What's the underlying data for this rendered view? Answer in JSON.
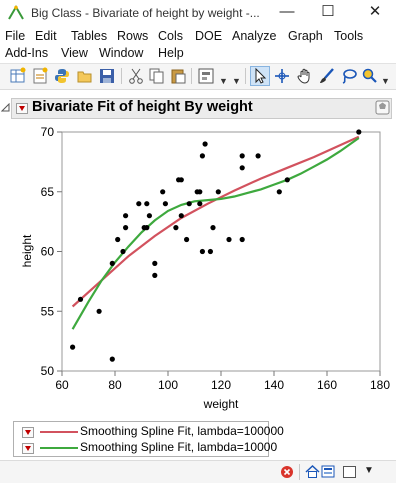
{
  "window": {
    "title": "Big Class - Bivariate of height by weight -...",
    "minimize_glyph": "—",
    "maximize_glyph": "☐",
    "close_glyph": "✕"
  },
  "menu": {
    "row1": [
      "File",
      "Edit",
      "Tables",
      "Rows",
      "Cols",
      "DOE",
      "Analyze",
      "Graph",
      "Tools"
    ],
    "row2": [
      "Add-Ins",
      "View",
      "Window",
      "Help"
    ]
  },
  "toolbar": {
    "icons": [
      "new-data-table-icon",
      "new-script-icon",
      "python-icon",
      "open-icon",
      "save-icon",
      "cut-icon",
      "copy-icon",
      "paste-icon",
      "report-icon",
      "arrow-tool-icon",
      "crosshair-tool-icon",
      "grabber-tool-icon",
      "brush-tool-icon",
      "lasso-tool-icon",
      "magnifier-tool-icon"
    ]
  },
  "report": {
    "title": "Bivariate Fit of height By weight"
  },
  "colors": {
    "spline1": "#d2525e",
    "spline2": "#3ea93e",
    "hot_triangle": "#c00000"
  },
  "chart_data": {
    "type": "scatter",
    "xlabel": "weight",
    "ylabel": "height",
    "xlim": [
      60,
      180
    ],
    "ylim": [
      50,
      70
    ],
    "xticks": [
      60,
      80,
      100,
      120,
      140,
      160,
      180
    ],
    "yticks": [
      50,
      55,
      60,
      65,
      70
    ],
    "points": [
      [
        64,
        52
      ],
      [
        67,
        56
      ],
      [
        74,
        55
      ],
      [
        79,
        51
      ],
      [
        79,
        59
      ],
      [
        81,
        61
      ],
      [
        83,
        60
      ],
      [
        84,
        62
      ],
      [
        84,
        63
      ],
      [
        89,
        64
      ],
      [
        91,
        62
      ],
      [
        92,
        64
      ],
      [
        92,
        62
      ],
      [
        93,
        63
      ],
      [
        95,
        59
      ],
      [
        95,
        58
      ],
      [
        98,
        65
      ],
      [
        99,
        64
      ],
      [
        103,
        62
      ],
      [
        104,
        66
      ],
      [
        105,
        63
      ],
      [
        105,
        66
      ],
      [
        107,
        61
      ],
      [
        108,
        64
      ],
      [
        111,
        65
      ],
      [
        112,
        65
      ],
      [
        112,
        64
      ],
      [
        113,
        68
      ],
      [
        113,
        60
      ],
      [
        114,
        69
      ],
      [
        116,
        60
      ],
      [
        117,
        62
      ],
      [
        119,
        65
      ],
      [
        123,
        61
      ],
      [
        128,
        68
      ],
      [
        128,
        67
      ],
      [
        128,
        61
      ],
      [
        134,
        68
      ],
      [
        142,
        65
      ],
      [
        145,
        66
      ],
      [
        172,
        70
      ]
    ],
    "series": [
      {
        "name": "Smoothing Spline Fit, lambda=100000",
        "points": [
          [
            64,
            55.4
          ],
          [
            75,
            57.6
          ],
          [
            85,
            59.6
          ],
          [
            95,
            61.3
          ],
          [
            105,
            62.8
          ],
          [
            115,
            64.0
          ],
          [
            125,
            65.1
          ],
          [
            135,
            66.1
          ],
          [
            145,
            67.0
          ],
          [
            155,
            67.9
          ],
          [
            165,
            68.9
          ],
          [
            172,
            69.6
          ]
        ]
      },
      {
        "name": "Smoothing Spline Fit, lambda=10000",
        "points": [
          [
            64,
            53.5
          ],
          [
            70,
            55.8
          ],
          [
            75,
            57.6
          ],
          [
            80,
            59.1
          ],
          [
            85,
            60.4
          ],
          [
            90,
            61.6
          ],
          [
            95,
            62.6
          ],
          [
            100,
            63.4
          ],
          [
            105,
            63.9
          ],
          [
            110,
            64.2
          ],
          [
            115,
            64.3
          ],
          [
            120,
            64.4
          ],
          [
            125,
            64.6
          ],
          [
            130,
            64.9
          ],
          [
            135,
            65.2
          ],
          [
            140,
            65.6
          ],
          [
            145,
            66.0
          ],
          [
            150,
            66.5
          ],
          [
            155,
            67.1
          ],
          [
            160,
            67.7
          ],
          [
            165,
            68.4
          ],
          [
            172,
            69.5
          ]
        ]
      }
    ],
    "grid": false,
    "legend": "bottom"
  }
}
